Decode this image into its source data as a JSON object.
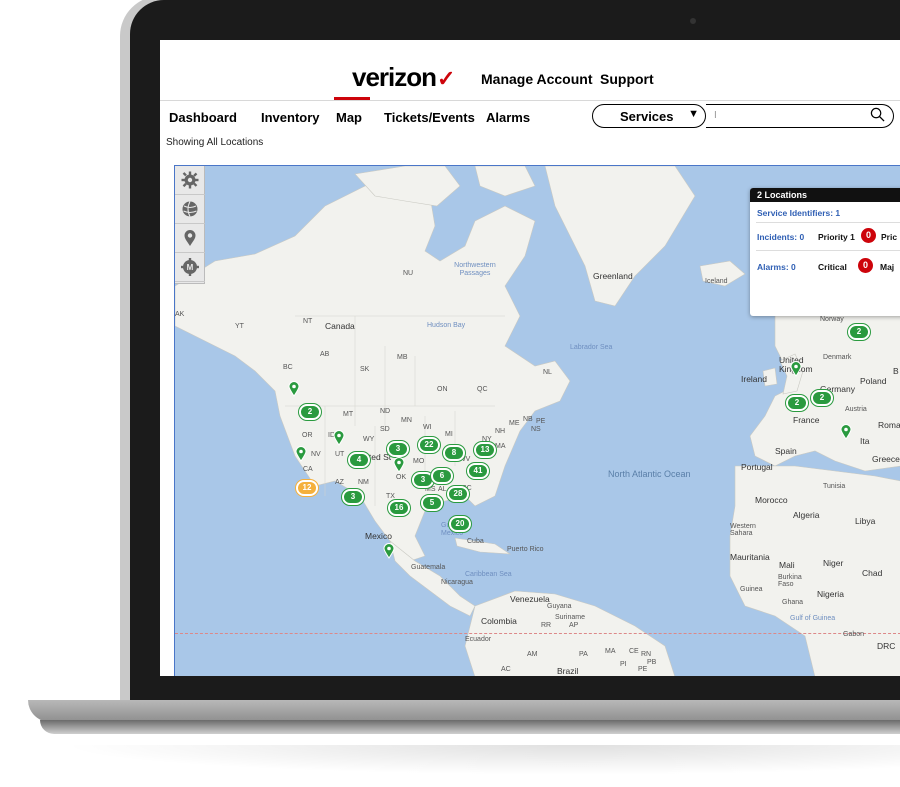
{
  "brand": {
    "name": "verizon",
    "check": "✓"
  },
  "top_nav": {
    "manage_account": "Manage Account",
    "support": "Support"
  },
  "tabs": [
    {
      "label": "Dashboard"
    },
    {
      "label": "Inventory"
    },
    {
      "label": "Map"
    },
    {
      "label": "Tickets/Events"
    },
    {
      "label": "Alarms"
    }
  ],
  "active_tab": "Map",
  "service_select": {
    "value": "Services"
  },
  "search": {
    "placeholder": "I"
  },
  "subtitle": "Showing All Locations",
  "tools": [
    {
      "icon": "gear-icon"
    },
    {
      "icon": "globe-icon"
    },
    {
      "icon": "location-pin-icon"
    },
    {
      "icon": "m-settings-icon"
    }
  ],
  "popup": {
    "title": "2 Locations",
    "service_identifiers": "Service Identifiers: 1",
    "incidents": "Incidents: 0",
    "priority1_label": "Priority 1",
    "priority1_count": "0",
    "priority_next_label": "Pric",
    "alarms": "Alarms: 0",
    "critical_label": "Critical",
    "critical_count": "0",
    "major_label": "Maj"
  },
  "map_labels": {
    "canada": "Canada",
    "hudson_bay": "Hudson Bay",
    "northwestern_passages": "Northwestern Passages",
    "greenland": "Greenland",
    "iceland": "Iceland",
    "labrador_sea": "Labrador Sea",
    "north_atlantic": "North Atlantic Ocean",
    "norway": "Norway",
    "united_kingdom": "United Kingdom",
    "ireland": "Ireland",
    "denmark": "Denmark",
    "germany": "Germany",
    "poland": "Poland",
    "france": "France",
    "austria": "Austria",
    "italy": "Ita",
    "spain": "Spain",
    "portugal": "Portugal",
    "greece": "Greece",
    "roma": "Roma",
    "morocco": "Morocco",
    "tunisia": "Tunisia",
    "algeria": "Algeria",
    "libya": "Libya",
    "western_sahara": "Western Sahara",
    "mauritania": "Mauritania",
    "mali": "Mali",
    "niger": "Niger",
    "chad": "Chad",
    "burkina_faso": "Burkina Faso",
    "guinea": "Guinea",
    "ghana": "Ghana",
    "nigeria": "Nigeria",
    "gulf_of_guinea": "Gulf of Guinea",
    "gabon": "Gabon",
    "drc": "DRC",
    "mexico": "Mexico",
    "gulf_of_mexico": "Gulf of Mexico",
    "cuba": "Cuba",
    "puerto_rico": "Puerto Rico",
    "caribbean_sea": "Caribbean Sea",
    "guatemala": "Guatemala",
    "nicaragua": "Nicaragua",
    "venezuela": "Venezuela",
    "colombia": "Colombia",
    "guyana": "Guyana",
    "suriname": "Suriname",
    "ecuador": "Ecuador",
    "brazil": "Brazil",
    "united_states": "ited St",
    "yt": "YT",
    "nt": "NT",
    "nu": "NU",
    "bc": "BC",
    "ab": "AB",
    "sk": "SK",
    "mb": "MB",
    "on": "ON",
    "qc": "QC",
    "nl": "NL",
    "nb": "NB",
    "pe": "PE",
    "ns": "NS",
    "mt": "MT",
    "nd": "ND",
    "mn": "MN",
    "wi": "WI",
    "mi": "MI",
    "sd": "SD",
    "or": "OR",
    "id": "ID",
    "wy": "WY",
    "ia": "IA",
    "ny": "NY",
    "me": "ME",
    "nv": "NV",
    "ut": "UT",
    "mo": "MO",
    "wv": "WV",
    "ca": "CA",
    "ok": "OK",
    "az": "AZ",
    "nm": "NM",
    "tx": "TX",
    "sc": "SC",
    "al": "AL",
    "ms": "MS",
    "nh": "NH",
    "ma": "MA",
    "ak": "AK",
    "am": "AM",
    "pa": "PA",
    "ma_br": "MA",
    "ce": "CE",
    "rn": "RN",
    "pb": "PB",
    "pi": "PI",
    "pe_br": "PE",
    "ac": "AC",
    "rr": "RR",
    "ap": "AP",
    "b": "B"
  },
  "clusters": [
    {
      "count": "2",
      "color": "green"
    },
    {
      "count": "4",
      "color": "green"
    },
    {
      "count": "3",
      "color": "green"
    },
    {
      "count": "22",
      "color": "green"
    },
    {
      "count": "8",
      "color": "green"
    },
    {
      "count": "13",
      "color": "green"
    },
    {
      "count": "41",
      "color": "green"
    },
    {
      "count": "3",
      "color": "green"
    },
    {
      "count": "6",
      "color": "green"
    },
    {
      "count": "12",
      "color": "orange"
    },
    {
      "count": "3",
      "color": "green"
    },
    {
      "count": "28",
      "color": "green"
    },
    {
      "count": "5",
      "color": "green"
    },
    {
      "count": "16",
      "color": "green"
    },
    {
      "count": "20",
      "color": "green"
    },
    {
      "count": "2",
      "color": "green"
    },
    {
      "count": "2",
      "color": "green"
    },
    {
      "count": "2",
      "color": "green"
    }
  ],
  "colors": {
    "brand_red": "#cd040b",
    "cluster_green": "#2a9a3f",
    "cluster_orange": "#f5b03c",
    "water": "#a9c7e8",
    "land": "#f2f2ee"
  }
}
